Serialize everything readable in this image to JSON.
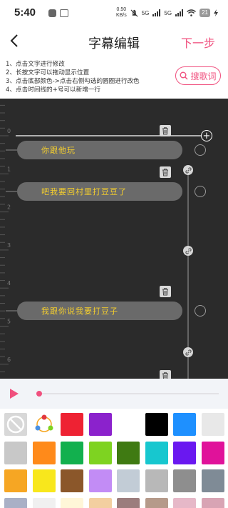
{
  "status": {
    "time": "5:40",
    "net_speed": "0.50",
    "net_unit": "KB/s",
    "signal1": "5G",
    "signal2": "5G",
    "battery": "21"
  },
  "header": {
    "title": "字幕编辑",
    "next": "下一步"
  },
  "tips": [
    "1、点击文字进行修改",
    "2、长按文字可以拖动显示位置",
    "3、点击底部颜色->点击右侧勾选的圆圈进行改色",
    "4、点击时间线的+号可以新增一行"
  ],
  "search_lyrics": "搜歌词",
  "ruler_labels": [
    "0",
    "1",
    "2",
    "3",
    "4",
    "5",
    "6"
  ],
  "subtitles": [
    {
      "text": "你跟他玩"
    },
    {
      "text": "吧我要回村里打豆豆了"
    },
    {
      "text": "我跟你说我要打豆子"
    }
  ],
  "colors": {
    "accent": "#f0507e",
    "editor_bg": "#2b2b2b",
    "subtitle_text": "#f4ce2e"
  },
  "palette": [
    {
      "name": "none-swatch",
      "color": "#d8d8d8"
    },
    {
      "name": "gradient-swatch",
      "color": "#ffffff"
    },
    {
      "name": "swatch-red",
      "color": "#ee2233"
    },
    {
      "name": "swatch-purple",
      "color": "#8b22cc"
    },
    {
      "name": "swatch-white",
      "color": "#ffffff"
    },
    {
      "name": "swatch-black",
      "color": "#000000"
    },
    {
      "name": "swatch-blue",
      "color": "#1e90ff"
    },
    {
      "name": "swatch-lightgray",
      "color": "#e8e8e8"
    },
    {
      "name": "swatch-gray",
      "color": "#c8c8c8"
    },
    {
      "name": "swatch-orange",
      "color": "#ff8a1a"
    },
    {
      "name": "swatch-green",
      "color": "#12b04e"
    },
    {
      "name": "swatch-lime",
      "color": "#7ed321"
    },
    {
      "name": "swatch-darkgreen",
      "color": "#3f7a12"
    },
    {
      "name": "swatch-cyan",
      "color": "#17c7cf"
    },
    {
      "name": "swatch-violet",
      "color": "#6a18f0"
    },
    {
      "name": "swatch-magenta",
      "color": "#e0129a"
    },
    {
      "name": "swatch-amber",
      "color": "#f6a623"
    },
    {
      "name": "swatch-yellow",
      "color": "#f8e71c"
    },
    {
      "name": "swatch-brown",
      "color": "#8b572a"
    },
    {
      "name": "swatch-lavender",
      "color": "#c28cf5"
    },
    {
      "name": "swatch-bluegray",
      "color": "#c2ccd6"
    },
    {
      "name": "swatch-silver",
      "color": "#b8b8b8"
    },
    {
      "name": "swatch-darkgray",
      "color": "#8e8e8e"
    },
    {
      "name": "swatch-slate",
      "color": "#7f8b96"
    },
    {
      "name": "swatch-steel",
      "color": "#a9b0c6"
    },
    {
      "name": "swatch-pale",
      "color": "#f0f0f0"
    },
    {
      "name": "swatch-cream",
      "color": "#fff6d8"
    },
    {
      "name": "swatch-peach",
      "color": "#f3cfa0"
    },
    {
      "name": "swatch-mauve",
      "color": "#9b7d7d"
    },
    {
      "name": "swatch-tan",
      "color": "#b59a8a"
    },
    {
      "name": "swatch-pink",
      "color": "#e6b8c8"
    },
    {
      "name": "swatch-rose",
      "color": "#d8a4b4"
    }
  ]
}
